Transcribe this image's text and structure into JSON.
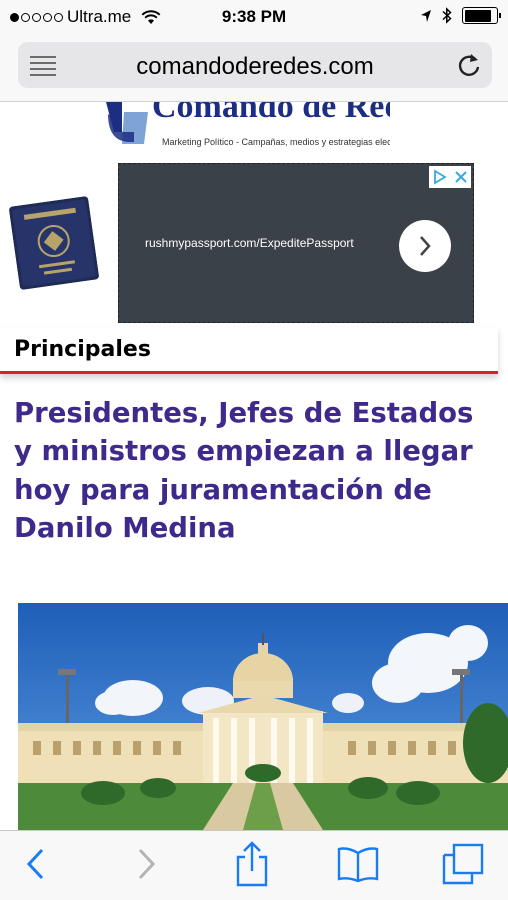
{
  "status_bar": {
    "carrier": "Ultra.me",
    "time": "9:38 PM",
    "signal_bars_filled": 1,
    "battery_level": 0.85
  },
  "browser": {
    "url": "comandoderedes.com",
    "reader_icon": "reader-view-icon",
    "reload_icon": "reload-icon"
  },
  "site": {
    "logo_text": "Comando de Redes",
    "logo_tagline": "Marketing Político - Campañas, medios y estrategias electorales"
  },
  "ad": {
    "url_text": "rushmypassport.com/ExpeditePassport",
    "image": "passport-image"
  },
  "section": {
    "title": "Principales"
  },
  "article": {
    "headline": "Presidentes, Jefes de Estados y ministros empiezan a llegar hoy para juramentación de Danilo Medina",
    "image": "national-palace-photo"
  },
  "colors": {
    "headline": "#3f2a8c",
    "section_rule": "#d4242b",
    "ios_blue": "#1a7cf5",
    "ad_background": "#3a4148"
  },
  "toolbar": {
    "back_icon": "back-chevron-icon",
    "forward_icon": "forward-chevron-icon",
    "share_icon": "share-icon",
    "bookmarks_icon": "bookmarks-icon",
    "tabs_icon": "tabs-icon"
  }
}
